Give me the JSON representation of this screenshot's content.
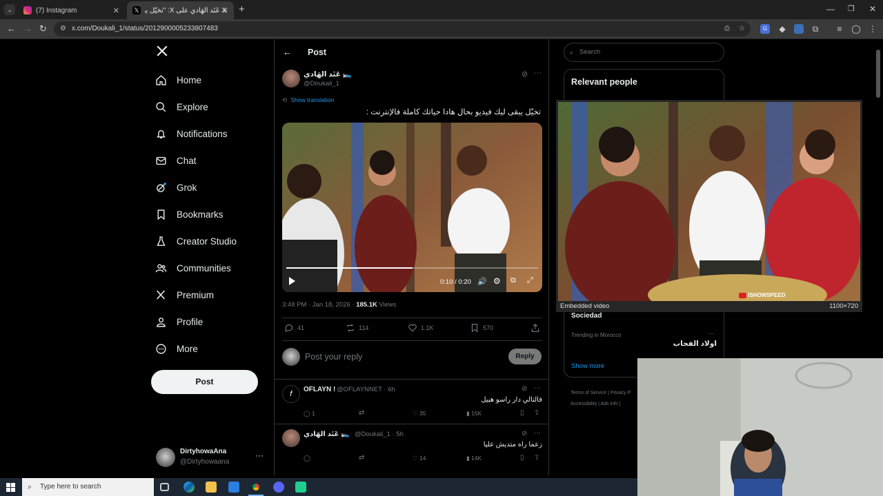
{
  "browser": {
    "tabs": [
      {
        "title": "(7) Instagram",
        "active": false
      },
      {
        "title": "X عَنَد الهَادي على X: \"تخيّل يبقى ...",
        "active": true
      }
    ],
    "new_tab": "+",
    "url": "x.com/Doukali_1/status/2012900005233807483"
  },
  "sidebar": {
    "items": [
      {
        "label": "Home",
        "icon": "home-icon"
      },
      {
        "label": "Explore",
        "icon": "search-icon"
      },
      {
        "label": "Notifications",
        "icon": "bell-icon"
      },
      {
        "label": "Chat",
        "icon": "mail-icon"
      },
      {
        "label": "Grok",
        "icon": "grok-icon"
      },
      {
        "label": "Bookmarks",
        "icon": "bookmark-icon"
      },
      {
        "label": "Creator Studio",
        "icon": "flask-icon"
      },
      {
        "label": "Communities",
        "icon": "people-icon"
      },
      {
        "label": "Premium",
        "icon": "x-icon"
      },
      {
        "label": "Profile",
        "icon": "person-icon"
      },
      {
        "label": "More",
        "icon": "more-circle-icon"
      }
    ],
    "post_button": "Post",
    "account": {
      "name": "DirtyhowaAna",
      "handle": "@Dirtyhowaana",
      "more": "···"
    }
  },
  "main": {
    "header": "Post",
    "tweet": {
      "author_name": "عَنَد الهَادي 🛌",
      "author_handle": "@Doukali_1",
      "show_translation": "Show translation",
      "text": "تخيّل يبقى ليك فيديو بحال هادا حياتك كاملة فالإنترنت :",
      "video_time": "0:10 / 0:20",
      "video_progress": 0.5,
      "watermark": "ISHOWSPEED",
      "timestamp": "3:48 PM · Jan 18, 2026 ·",
      "views_count": "185.1K",
      "views_label": "Views",
      "stats": {
        "replies": "41",
        "reposts": "114",
        "likes": "1.1K",
        "bookmarks": "570"
      }
    },
    "reply_box": {
      "placeholder": "Post your reply",
      "button": "Reply"
    },
    "replies": [
      {
        "name": "OFLAYN !",
        "handle": "@OFLAYNNET · 6h",
        "text": "فالتالي دار راسو هبيل",
        "replies": "1",
        "likes": "35",
        "views": "15K"
      },
      {
        "name": "عَنَد الهَادي 🛌",
        "handle": "@Doukali_1 · 5h",
        "text": "زعما راه متديش عليا",
        "replies": "",
        "likes": "14",
        "views": "14K"
      }
    ]
  },
  "right": {
    "search_placeholder": "Search",
    "relevant_title": "Relevant people",
    "trend1": "Sociedad",
    "trend2_meta": "Trending in Morocco",
    "trend2_name": "اولاد الفحاب",
    "trend_more": "···",
    "show_more": "Show more",
    "footer": [
      "Terms of Service",
      "Privacy P",
      "Accessibility",
      "Ads info"
    ]
  },
  "embed": {
    "label": "Embedded video",
    "size": "1100×720",
    "watermark": "ISHOWSPEED"
  },
  "taskbar": {
    "search_placeholder": "Type here to search"
  }
}
